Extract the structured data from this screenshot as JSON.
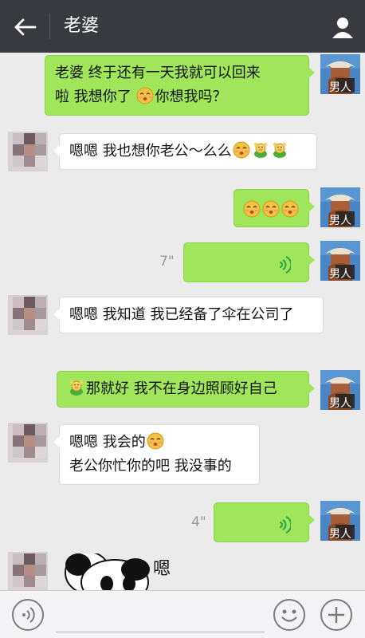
{
  "header": {
    "title": "老婆",
    "back_icon": "arrow-left-icon",
    "contact_icon": "person-icon"
  },
  "messages": [
    {
      "from": "me",
      "type": "text",
      "text1": "老婆 终于还有一天我就可以回来",
      "text2": "啦 我想你了",
      "text3": "你想我吗？"
    },
    {
      "from": "her",
      "type": "text",
      "text": "嗯嗯 我也想你老公～么么"
    },
    {
      "from": "me",
      "type": "emoji"
    },
    {
      "from": "me",
      "type": "voice",
      "duration": "7\""
    },
    {
      "from": "her",
      "type": "text",
      "text": "嗯嗯 我知道 我已经备了伞在公司了"
    },
    {
      "from": "me",
      "type": "text",
      "text": "那就好 我不在身边照顾好自己"
    },
    {
      "from": "her",
      "type": "text",
      "line1": "嗯嗯 我会的",
      "line2": "老公你忙你的吧 我没事的"
    },
    {
      "from": "me",
      "type": "voice",
      "duration": "4\""
    },
    {
      "from": "her",
      "type": "sticker",
      "sticker_text": "嗯"
    }
  ],
  "avatar_badge": "男人",
  "input": {
    "value": ""
  },
  "colors": {
    "topbar": "#393a3f",
    "bubble_me": "#a0e65a",
    "bubble_her": "#ffffff",
    "background": "#ebebeb",
    "voice_wave": "#2fa84f"
  },
  "icons": {
    "voice_toggle": "voice-wave-icon",
    "emoji": "smiley-icon",
    "plus": "plus-icon",
    "kiss_emoji": "kiss-emoji-icon",
    "pig_emoji": "pig-emoji-icon"
  }
}
